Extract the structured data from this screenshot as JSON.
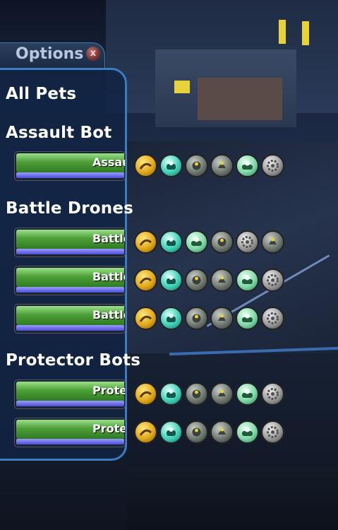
{
  "window": {
    "title": "Options",
    "close_label": "x"
  },
  "groups": [
    {
      "label": "All Pets",
      "pets": []
    },
    {
      "label": "Assault Bot",
      "pets": [
        {
          "name": "Assault Bot",
          "hp": 0.98,
          "energy": 0.98,
          "icons": [
            "gold-swirl-icon",
            "teal-turret-icon",
            "gray-gear-icon",
            "gray-bell-icon",
            "mint-turret-icon",
            "silver-cog-icon"
          ]
        }
      ]
    },
    {
      "label": "Battle Drones",
      "pets": [
        {
          "name": "Battle Drone",
          "hp": 0.98,
          "energy": 0.98,
          "icons": [
            "gold-swirl-icon",
            "teal-turret-icon",
            "mint-turret-icon",
            "gray-gear-icon",
            "silver-cog-icon",
            "gray-bell-icon"
          ]
        },
        {
          "name": "Battle Drone",
          "hp": 0.98,
          "energy": 0.98,
          "icons": [
            "gold-swirl-icon",
            "teal-turret-icon",
            "gray-gear-icon",
            "gray-bell-icon",
            "mint-turret-icon",
            "silver-cog-icon"
          ]
        },
        {
          "name": "Battle Drone",
          "hp": 0.98,
          "energy": 0.98,
          "icons": [
            "gold-swirl-icon",
            "teal-turret-icon",
            "gray-gear-icon",
            "gray-bell-icon",
            "mint-turret-icon",
            "silver-cog-icon"
          ]
        }
      ]
    },
    {
      "label": "Protector Bots",
      "pets": [
        {
          "name": "Protector Bot",
          "hp": 0.98,
          "energy": 0.98,
          "icons": [
            "gold-swirl-icon",
            "teal-turret-icon",
            "gray-gear-icon",
            "gray-bell-icon",
            "mint-turret-icon",
            "silver-cog-icon"
          ]
        },
        {
          "name": "Protector Bot",
          "hp": 0.98,
          "energy": 0.98,
          "icons": [
            "gold-swirl-icon",
            "teal-turret-icon",
            "gray-gear-icon",
            "gray-bell-icon",
            "mint-turret-icon",
            "silver-cog-icon"
          ]
        }
      ]
    }
  ],
  "colors": {
    "panel_border": "#3d7cc0",
    "health": "#4ea03a",
    "energy": "#4e4ed6"
  }
}
